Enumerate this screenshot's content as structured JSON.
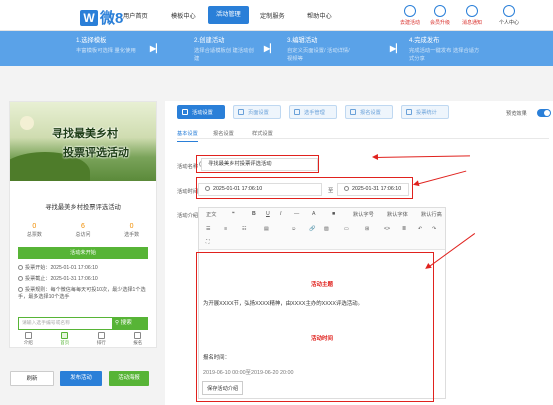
{
  "brand": {
    "mark": "W",
    "name": "微8"
  },
  "nav": [
    "用户首页",
    "模板中心",
    "活动管理",
    "定制服务",
    "帮助中心"
  ],
  "nav_active": "活动管理",
  "top_icons": [
    {
      "label": "去建活动",
      "icon": "create-icon",
      "color": "#d9302c"
    },
    {
      "label": "会员升级",
      "icon": "upgrade-icon",
      "color": "#d9302c"
    },
    {
      "label": "消息通知",
      "icon": "bell-icon",
      "color": "#d9302c"
    },
    {
      "label": "个人中心",
      "icon": "user-icon",
      "color": "#333333"
    }
  ],
  "steps": [
    {
      "title": "1.选择模板",
      "desc": "丰富模板可选择 量化使用"
    },
    {
      "title": "2.创建活动",
      "desc": "选择合适模板创 建活动创建"
    },
    {
      "title": "3.编辑活动",
      "desc": "自定义页面设置/ 活动详情/视频等"
    },
    {
      "title": "4.完成发布",
      "desc": "完成活动一键发布 选择合适方式分享"
    }
  ],
  "phone": {
    "banner_line1": "寻找最美乡村",
    "banner_line2": "投票评选活动",
    "title": "寻找最美乡村投票评选活动",
    "stats": [
      {
        "value": "0",
        "label": "总票数"
      },
      {
        "value": "6",
        "label": "总访问"
      },
      {
        "value": "0",
        "label": "选手数"
      }
    ],
    "status_button": "活动未开始",
    "start_line": "投票开始：2025-01-01 17:06:10",
    "end_line": "投票截止：2025-01-31 17:06:10",
    "rule_line": "投票规则：每个微信每每天可投10次，最少选择1个选手，最多选择10个选手",
    "search_placeholder": "请输入选手编号或名称",
    "search_button": "搜索",
    "tabs": [
      "介绍",
      "首页",
      "排行",
      "报名"
    ]
  },
  "bottom_buttons": [
    {
      "label": "刷新",
      "color": "#ffffff"
    },
    {
      "label": "发布活动",
      "color": "#2a7fd8"
    },
    {
      "label": "活动海报",
      "color": "#57b436"
    }
  ],
  "settings_tabs": [
    "活动设置",
    "页面设置",
    "选手管理",
    "报名设置",
    "投票统计"
  ],
  "preview_label": "预览效果",
  "sub_tabs": [
    "基本设置",
    "报名设置",
    "样式设置"
  ],
  "form": {
    "name_label": "活动名称",
    "name_value": "寻找最美乡村投票评选活动",
    "time_label": "活动时间",
    "time_start": "2025-01-01 17:06:10",
    "time_sep": "至",
    "time_end": "2025-01-31 17:06:10",
    "intro_label": "活动介绍"
  },
  "toolbar": {
    "row1": [
      "正文",
      "❝",
      "B",
      "U",
      "I",
      "—",
      "A",
      "■",
      "默认字号",
      "默认字体",
      "默认行高"
    ],
    "row2": [
      "☰",
      "≡",
      "☷",
      "▤",
      "☺",
      "🔗",
      "▨",
      "▭",
      "⊞",
      "<>",
      "≣",
      "↶",
      "↷"
    ],
    "row3": [
      "⛶"
    ]
  },
  "editor": {
    "heading1": "活动主题",
    "body1": "为开展XXXX节，弘扬XXXX精神，由XXXX主办的XXXX评选活动。",
    "heading2": "活动时间",
    "body2": "报名时间：",
    "body3": "2019-06-10 00:00至2019-06-20 20:00"
  },
  "save_intro_button": "保存活动介绍"
}
